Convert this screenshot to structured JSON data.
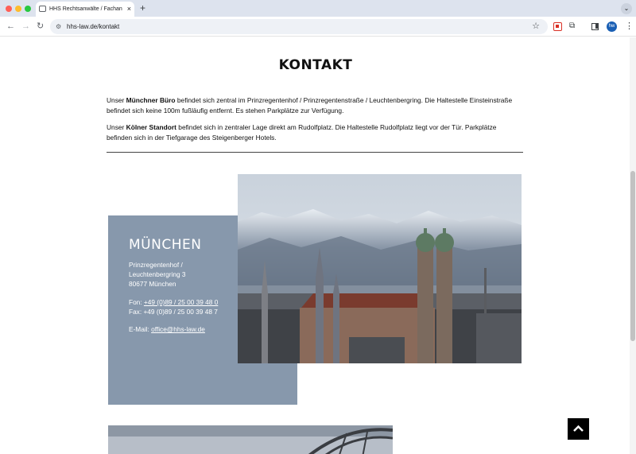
{
  "browser": {
    "tab_title": "HHS Rechtsanwälte / Fachanwälte",
    "tab_close": "×",
    "new_tab": "+",
    "url": "hhs-law.de/kontakt",
    "profile_initials": "hw",
    "icons": [
      "back-icon",
      "forward-icon",
      "reload-icon",
      "site-info-icon",
      "bookmark-star-icon",
      "extension-icon",
      "puzzle-icon",
      "side-panel-icon",
      "menu-icon"
    ]
  },
  "page": {
    "title": "KONTAKT",
    "p1": {
      "before": "Unser ",
      "bold": "Münchner Büro",
      "after": " befindet sich zentral im Prinzregentenhof / Prinzregentenstraße / Leuchtenbergring. Die Haltestelle Ein­steinstraße befindet sich keine 100m fußläufig entfernt. Es stehen Parkplätze zur Verfügung."
    },
    "p2": {
      "before": "Unser ",
      "bold": "Kölner Standort",
      "after": " befindet sich in zentraler Lage direkt am Rudolfplatz. Die Haltestelle Rudolfplatz liegt vor der Tür. Park­plätze befinden sich in der Tiefgarage des Steigenberger Hotels."
    },
    "office": {
      "city": "MÜNCHEN",
      "address_line1": "Prinzregentenhof /",
      "address_line2": "Leuchtenbergring 3",
      "address_line3": "80677 München",
      "phone_label": "Fon: ",
      "phone": "+49 (0)89 / 25 00 39 48 0",
      "fax": "Fax: +49 (0)89 / 25 00 39 48 7",
      "email_label": "E-Mail: ",
      "email": "office@hhs-law.de"
    }
  },
  "colors": {
    "card_bg": "#8798ac",
    "scroll_top_bg": "#000000",
    "tabbar_bg": "#dde3ee"
  }
}
